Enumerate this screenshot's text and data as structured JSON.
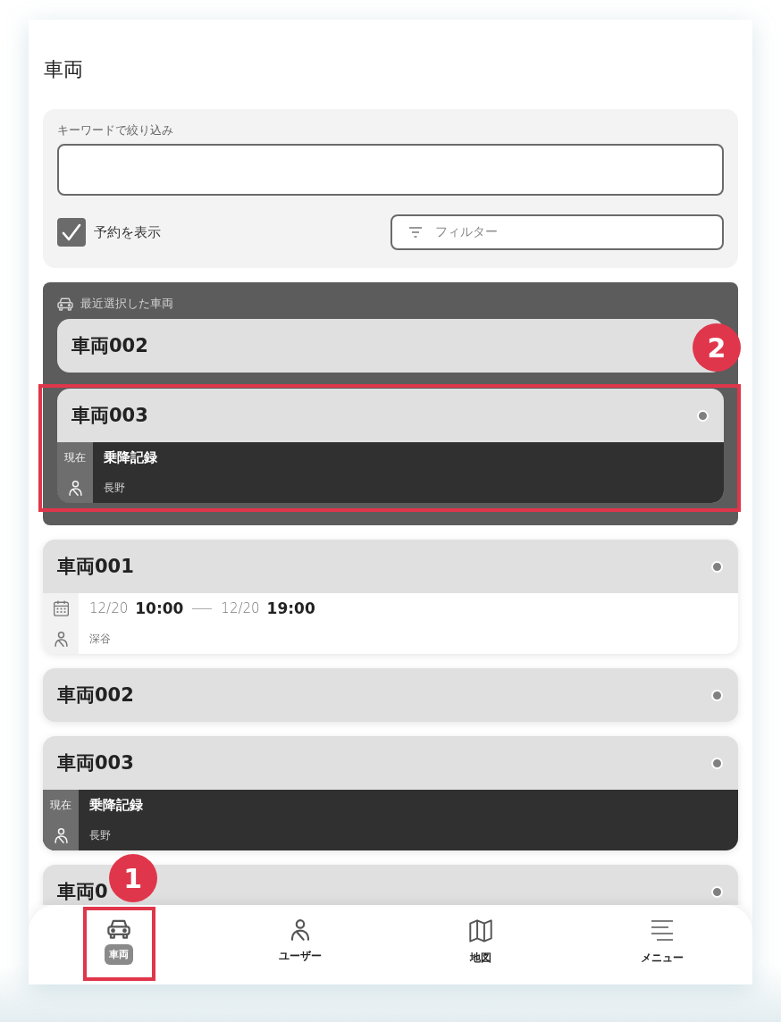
{
  "page": {
    "title": "車両"
  },
  "filter": {
    "keyword_label": "キーワードで絞り込み",
    "show_reservations": {
      "label": "予約を表示",
      "checked": true
    },
    "filter_button": {
      "label": "フィルター"
    }
  },
  "recent": {
    "title": "最近選択した車両",
    "vehicles": [
      {
        "name": "車両002",
        "kind": "basic",
        "indicator": false
      },
      {
        "name": "車両003",
        "kind": "current",
        "indicator": true,
        "status_label": "現在",
        "activity": "乗降記録",
        "user": "長野",
        "callout": "2"
      }
    ]
  },
  "vehicles": [
    {
      "name": "車両001",
      "kind": "reservation",
      "indicator": true,
      "start_date": "12/20",
      "start_time": "10:00",
      "end_date": "12/20",
      "end_time": "19:00",
      "user": "深谷"
    },
    {
      "name": "車両002",
      "kind": "basic",
      "indicator": true
    },
    {
      "name": "車両003",
      "kind": "current",
      "indicator": true,
      "status_label": "現在",
      "activity": "乗降記録",
      "user": "長野"
    },
    {
      "name": "車両0",
      "kind": "basic",
      "indicator": true
    }
  ],
  "nav": [
    {
      "label": "車両",
      "kind": "car",
      "selected": true,
      "callout": "1"
    },
    {
      "label": "ユーザー",
      "kind": "user",
      "selected": false
    },
    {
      "label": "地図",
      "kind": "map",
      "selected": false
    },
    {
      "label": "メニュー",
      "kind": "menu",
      "selected": false
    }
  ]
}
